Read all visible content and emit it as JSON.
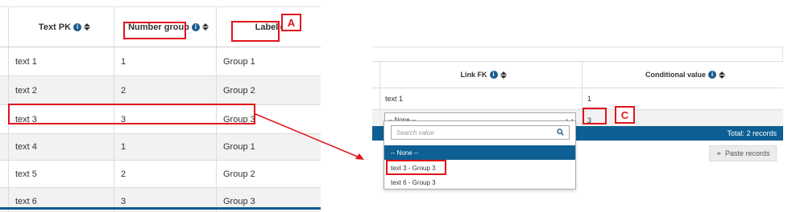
{
  "left_table": {
    "columns": [
      "Text PK",
      "Number group",
      "Label"
    ],
    "rows": [
      [
        "text 1",
        "1",
        "Group 1"
      ],
      [
        "text 2",
        "2",
        "Group 2"
      ],
      [
        "text 3",
        "3",
        "Group 3"
      ],
      [
        "text 4",
        "1",
        "Group 1"
      ],
      [
        "text 5",
        "2",
        "Group 2"
      ],
      [
        "text 6",
        "3",
        "Group 3"
      ]
    ]
  },
  "right_table": {
    "columns": [
      "Link FK",
      "Conditional value"
    ],
    "row1": [
      "text 1",
      "1"
    ],
    "row2_select_value": "-- None --",
    "row2_conditional_value": "3",
    "footer_total": "Total: 2 records",
    "paste_button": "Paste records"
  },
  "dropdown": {
    "search_placeholder": "Search value",
    "options": [
      "-- None --",
      "text 3 - Group 3",
      "text 6 - Group 3"
    ]
  },
  "markers": {
    "a": "A",
    "c": "C"
  },
  "colors": {
    "accent": "#0e5f93",
    "highlight": "#e1141b"
  }
}
